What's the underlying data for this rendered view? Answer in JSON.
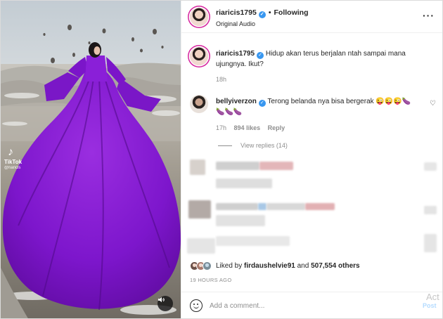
{
  "media": {
    "tiktok_brand": "TikTok",
    "tiktok_handle": "@riaricis",
    "icons": {
      "tiktok": "tiktok-note-icon",
      "sound": "speaker-muted-icon"
    }
  },
  "header": {
    "username": "riaricis1795",
    "follow_status": "Following",
    "audio_label": "Original Audio"
  },
  "caption": {
    "username": "riaricis1795",
    "text": "Hidup akan terus berjalan ntah sampai mana ujungnya. Ikut?",
    "time": "18h"
  },
  "comments": [
    {
      "username": "bellyiverzon",
      "text": "Terong belanda nya bisa bergerak 😜😜😜🍆",
      "text_line2": "🍆🍆🍆",
      "time": "17h",
      "likes": "894 likes",
      "reply_label": "Reply",
      "view_replies": "View replies (14)"
    }
  ],
  "likes": {
    "prefix": "Liked by",
    "user": "firdaushelvie91",
    "conjunction": "and",
    "count": "507,554 others"
  },
  "post_time": "19 HOURS AGO",
  "comment_box": {
    "placeholder": "Add a comment...",
    "post_label": "Post"
  },
  "watermark": "Act",
  "colors": {
    "accent": "#3897f0",
    "dress": "#8b1fd6",
    "muted": "#8e8e8e"
  }
}
